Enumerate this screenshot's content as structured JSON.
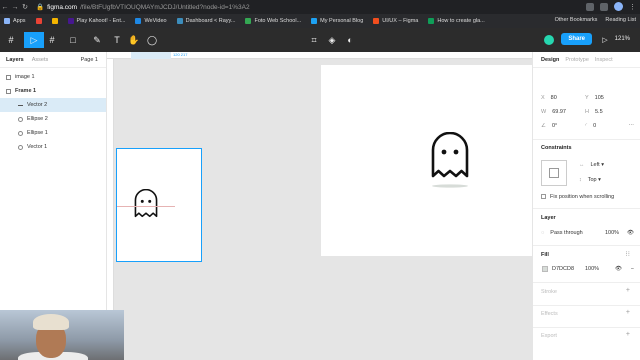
{
  "browser": {
    "url_host": "figma.com",
    "url_path": "/file/BtFUgfbVTIOUQMAYmJCDJ/Untitled?node-id=1%3A2"
  },
  "bookmarks": {
    "items": [
      {
        "label": "Apps",
        "color": "#8ab4f8"
      },
      {
        "label": "",
        "color": "#ea4335"
      },
      {
        "label": "",
        "color": "#f4b400"
      },
      {
        "label": "Play Kahoot! - Ent...",
        "color": "#46178f"
      },
      {
        "label": "WeVideo",
        "color": "#1e88e5"
      },
      {
        "label": "Dashboard < Rayy...",
        "color": "#3c8dbc"
      },
      {
        "label": "Foto Web School...",
        "color": "#34a853"
      },
      {
        "label": "My Personal Blog",
        "color": "#1da1f2"
      },
      {
        "label": "UI/UX – Figma",
        "color": "#f24e1e"
      },
      {
        "label": "How to create gla...",
        "color": "#0f9d58"
      }
    ],
    "right": [
      "Other Bookmarks",
      "Reading List"
    ]
  },
  "toolbar": {
    "share_label": "Share",
    "zoom_label": "121%",
    "tools": [
      "#",
      "▷",
      "□",
      "✎",
      "T",
      "✋",
      "◯"
    ],
    "center_tools": [
      "⌗",
      "◈",
      "◐"
    ]
  },
  "left_panel": {
    "tabs": [
      "Layers",
      "Assets"
    ],
    "page_label": "Page 1",
    "layers": [
      {
        "label": "image 1",
        "type": "rect",
        "indent": 1,
        "selected": false
      },
      {
        "label": "Frame 1",
        "type": "frame",
        "indent": 1,
        "selected": false
      },
      {
        "label": "Vector 2",
        "type": "line",
        "indent": 2,
        "selected": true
      },
      {
        "label": "Ellipse 2",
        "type": "circ",
        "indent": 2,
        "selected": false
      },
      {
        "label": "Ellipse 1",
        "type": "circ",
        "indent": 2,
        "selected": false
      },
      {
        "label": "Vector 1",
        "type": "circ",
        "indent": 2,
        "selected": false
      }
    ]
  },
  "canvas": {
    "ruler_label": "120 217"
  },
  "right_panel": {
    "tabs": [
      "Design",
      "Prototype",
      "Inspect"
    ],
    "x": "80",
    "y": "105",
    "w": "69.97",
    "h": "5.5",
    "rotation": "0°",
    "radius": "0",
    "constraints_title": "Constraints",
    "constraint_h": "Left",
    "constraint_v": "Top",
    "fix_label": "Fix position when scrolling",
    "layer_title": "Layer",
    "blend": "Pass through",
    "layer_opacity": "100%",
    "fill_title": "Fill",
    "fill_hex": "D7DCD8",
    "fill_opacity": "100%",
    "fill_color": "#d7dcd8",
    "stroke_title": "Stroke",
    "effects_title": "Effects",
    "export_title": "Export"
  }
}
